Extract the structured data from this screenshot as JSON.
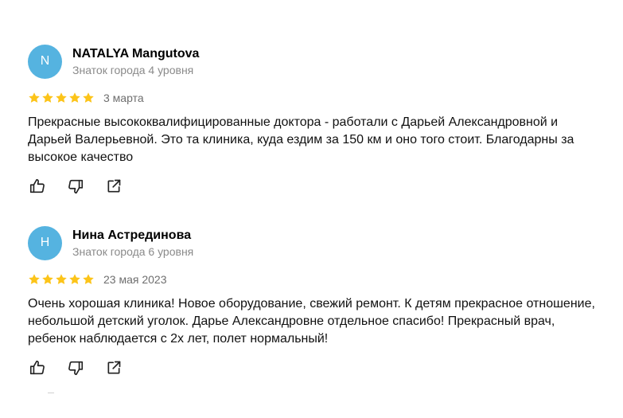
{
  "colors": {
    "avatar_bg": "#55b3e0",
    "star": "#fcc419",
    "secondary_text": "#8a8a8a"
  },
  "reviews": [
    {
      "avatar_letter": "N",
      "author": "NATALYA Mangutova",
      "level": "Знаток города 4 уровня",
      "rating": 5,
      "date": "3 марта",
      "text": "Прекрасные высококвалифицированные доктора - работали с Дарьей Александровной и Дарьей Валерьевной. Это та клиника, куда ездим за 150 км и оно того стоит. Благодарны за высокое качество",
      "actions": [
        "like-icon",
        "dislike-icon",
        "share-icon"
      ]
    },
    {
      "avatar_letter": "Н",
      "author": "Нина Астрединова",
      "level": "Знаток города 6 уровня",
      "rating": 5,
      "date": "23 мая 2023",
      "text": "Очень хорошая клиника! Новое оборудование, свежий ремонт. К детям прекрасное отношение, небольшой детский уголок. Дарье Александровне отдельное спасибо! Прекрасный врач, ребенок наблюдается с 2х лет, полет нормальный!",
      "actions": [
        "like-icon",
        "dislike-icon",
        "share-icon"
      ]
    }
  ]
}
